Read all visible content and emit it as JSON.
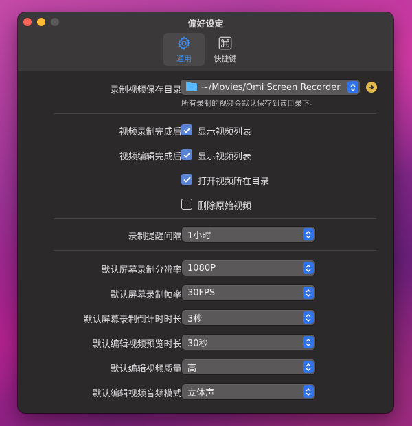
{
  "window": {
    "title": "偏好设定"
  },
  "tabs": [
    {
      "label": "通用",
      "icon": "gear-icon",
      "active": true
    },
    {
      "label": "快捷键",
      "icon": "command-icon",
      "active": false
    }
  ],
  "save_dir": {
    "label": "录制视频保存目录:",
    "value": "~/Movies/Omi Screen Recorder",
    "hint": "所有录制的视频会默认保存到该目录下。"
  },
  "after_record": {
    "label": "视频录制完成后:",
    "option_label": "显示视频列表",
    "checked": true
  },
  "after_edit": {
    "label": "视频编辑完成后:",
    "options": [
      {
        "label": "显示视频列表",
        "checked": true
      },
      {
        "label": "打开视频所在目录",
        "checked": true
      },
      {
        "label": "删除原始视频",
        "checked": false
      }
    ]
  },
  "reminder": {
    "label": "录制提醒间隔:",
    "value": "1小时"
  },
  "settings": [
    {
      "label": "默认屏幕录制分辨率:",
      "value": "1080P"
    },
    {
      "label": "默认屏幕录制帧率:",
      "value": "30FPS"
    },
    {
      "label": "默认屏幕录制倒计时时长:",
      "value": "3秒"
    },
    {
      "label": "默认编辑视频预览时长:",
      "value": "30秒"
    },
    {
      "label": "默认编辑视频质量:",
      "value": "高"
    },
    {
      "label": "默认编辑视频音频模式:",
      "value": "立体声"
    }
  ],
  "colors": {
    "accent": "#3274e8",
    "tab_active_text": "#3d8cf0",
    "window_bg": "#2b292a"
  }
}
